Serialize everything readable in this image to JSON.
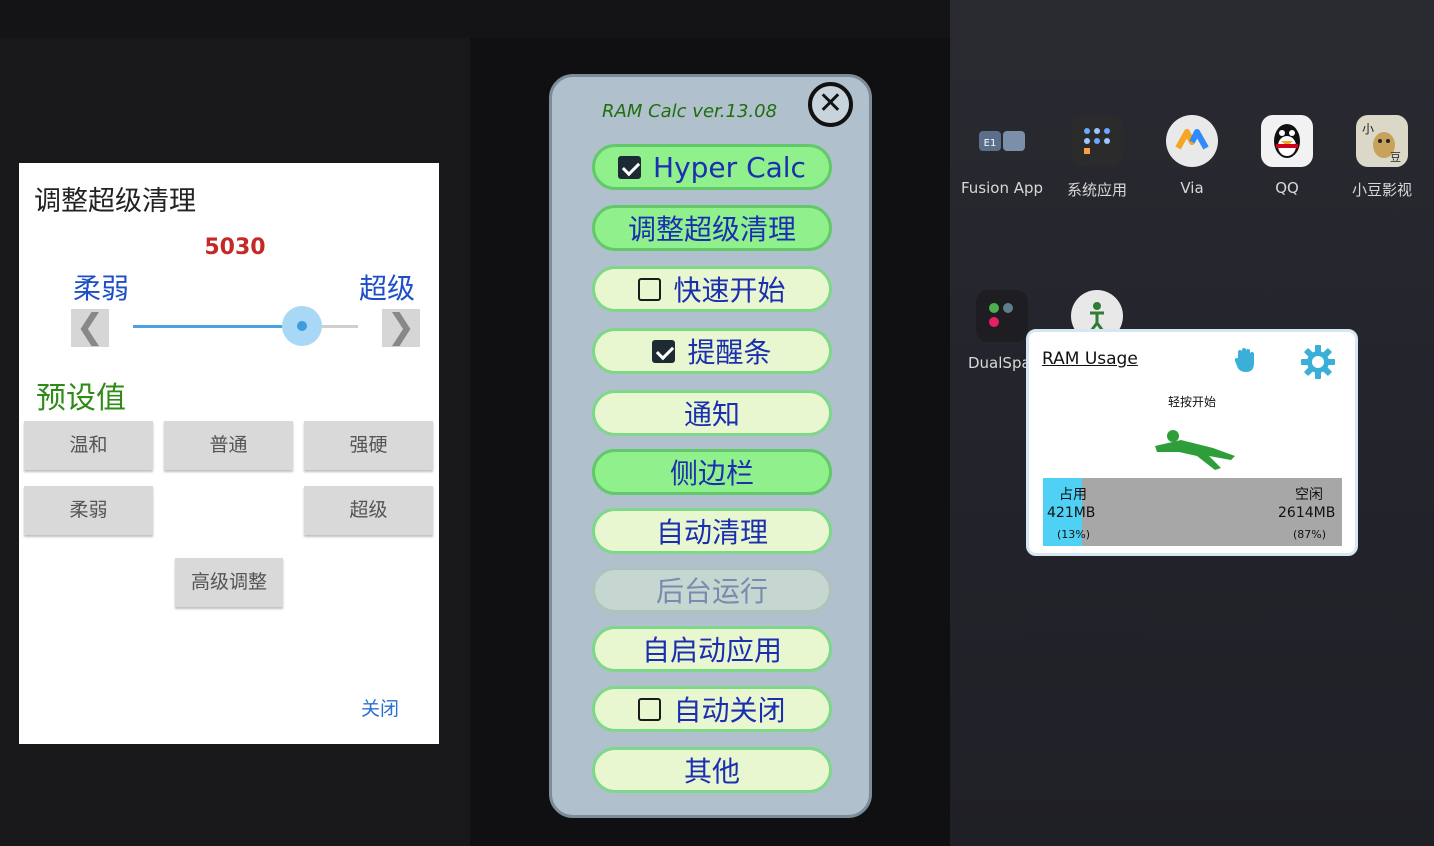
{
  "background": {
    "apps_right": [
      {
        "name": "Fusion App",
        "icon": "fusion-app-icon"
      },
      {
        "name": "系统应用",
        "icon": "system-apps-icon"
      },
      {
        "name": "Via",
        "icon": "via-browser-icon"
      },
      {
        "name": "QQ",
        "icon": "qq-penguin-icon"
      },
      {
        "name": "小豆影视",
        "icon": "bean-video-icon"
      }
    ],
    "apps_right_row2": [
      {
        "name": "DualSpac",
        "icon": "dualspace-icon"
      },
      {
        "name": "",
        "icon": "accessibility-icon"
      }
    ]
  },
  "tune_dialog": {
    "title": "调整超级清理",
    "value": "5030",
    "value_fraction": 0.75,
    "label_weak": "柔弱",
    "label_super": "超级",
    "left_arrow": "❮",
    "right_arrow": "❯",
    "preset_title": "预设值",
    "presets": {
      "gentle": "温和",
      "normal": "普通",
      "strong": "强硬",
      "weak": "柔弱",
      "super": "超级"
    },
    "advanced": "高级调整",
    "close": "关闭"
  },
  "menu": {
    "title": "RAM Calc ver.13.08",
    "close_symbol": "✕",
    "items": [
      {
        "label": "Hyper Calc",
        "checkbox": true,
        "checked": true,
        "state": "on"
      },
      {
        "label": "调整超级清理",
        "checkbox": false,
        "state": "on"
      },
      {
        "label": "快速开始",
        "checkbox": true,
        "checked": false,
        "state": "normal"
      },
      {
        "label": "提醒条",
        "checkbox": true,
        "checked": true,
        "state": "normal"
      },
      {
        "label": "通知",
        "checkbox": false,
        "state": "normal"
      },
      {
        "label": "侧边栏",
        "checkbox": false,
        "state": "on"
      },
      {
        "label": "自动清理",
        "checkbox": false,
        "state": "normal"
      },
      {
        "label": "后台运行",
        "checkbox": false,
        "state": "disabled"
      },
      {
        "label": "自启动应用",
        "checkbox": false,
        "state": "normal"
      },
      {
        "label": "自动关闭",
        "checkbox": true,
        "checked": false,
        "state": "normal"
      },
      {
        "label": "其他",
        "checkbox": false,
        "state": "normal"
      }
    ]
  },
  "ram_widget": {
    "title": "RAM Usage",
    "fist_icon": "fist-icon",
    "settings_icon": "gear-icon",
    "tap_text": "轻按开始",
    "runner_icon": "running-man-icon",
    "used_label": "占用",
    "used_value": "421MB",
    "used_percent": "(13%)",
    "used_fraction": 0.13,
    "free_label": "空闲",
    "free_value": "2614MB",
    "free_percent": "(87%)",
    "colors": {
      "used": "#4fd0f5",
      "free": "#a7a7a7",
      "accent": "#3ab0d8"
    }
  }
}
